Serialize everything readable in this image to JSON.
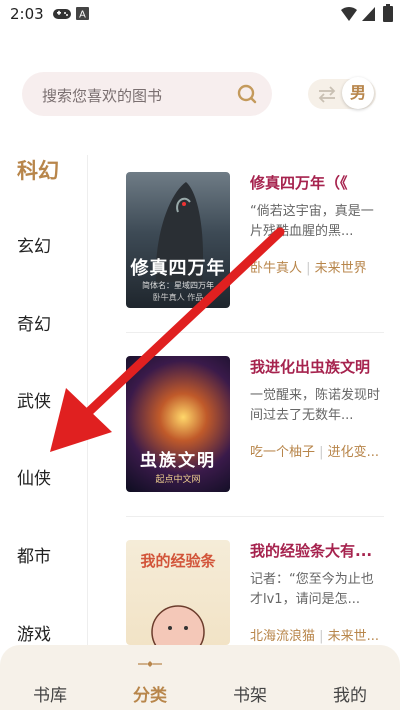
{
  "status_bar": {
    "time": "2:03",
    "icons": [
      "gamepad-icon",
      "a-badge-icon",
      "wifi-icon",
      "signal-icon",
      "battery-icon"
    ]
  },
  "search": {
    "placeholder": "搜索您喜欢的图书"
  },
  "gender_toggle": {
    "label": "男"
  },
  "categories": {
    "active": "科幻",
    "items": [
      "玄幻",
      "奇幻",
      "武侠",
      "仙侠",
      "都市",
      "游戏"
    ]
  },
  "books": [
    {
      "title": "修真四万年（《",
      "desc": "“倘若这宇宙，真是一片残酷血腥的黑...",
      "author": "卧牛真人",
      "tag": "未来世界",
      "cover": {
        "main": "修真四万年",
        "sub1": "简体名：星域四万年",
        "sub2": "卧牛真人 作品"
      }
    },
    {
      "title": "我进化出虫族文明",
      "desc": "一觉醒来，陈诺发现时间过去了无数年...",
      "author": "吃一个柚子",
      "tag": "进化变...",
      "cover": {
        "main": "虫族文明",
        "sub1": "起点中文网"
      }
    },
    {
      "title": "我的经验条大有...",
      "desc": "记者：“您至今为止也才lv1，请问是怎...",
      "author": "北海流浪猫",
      "tag": "未来世...",
      "cover": {
        "main": "我的经验条"
      }
    }
  ],
  "bottom_nav": {
    "items": [
      "书库",
      "分类",
      "书架",
      "我的"
    ],
    "active": "分类"
  },
  "colors": {
    "accent": "#b8864b",
    "title": "#a6234e",
    "arrow": "#e02020"
  }
}
